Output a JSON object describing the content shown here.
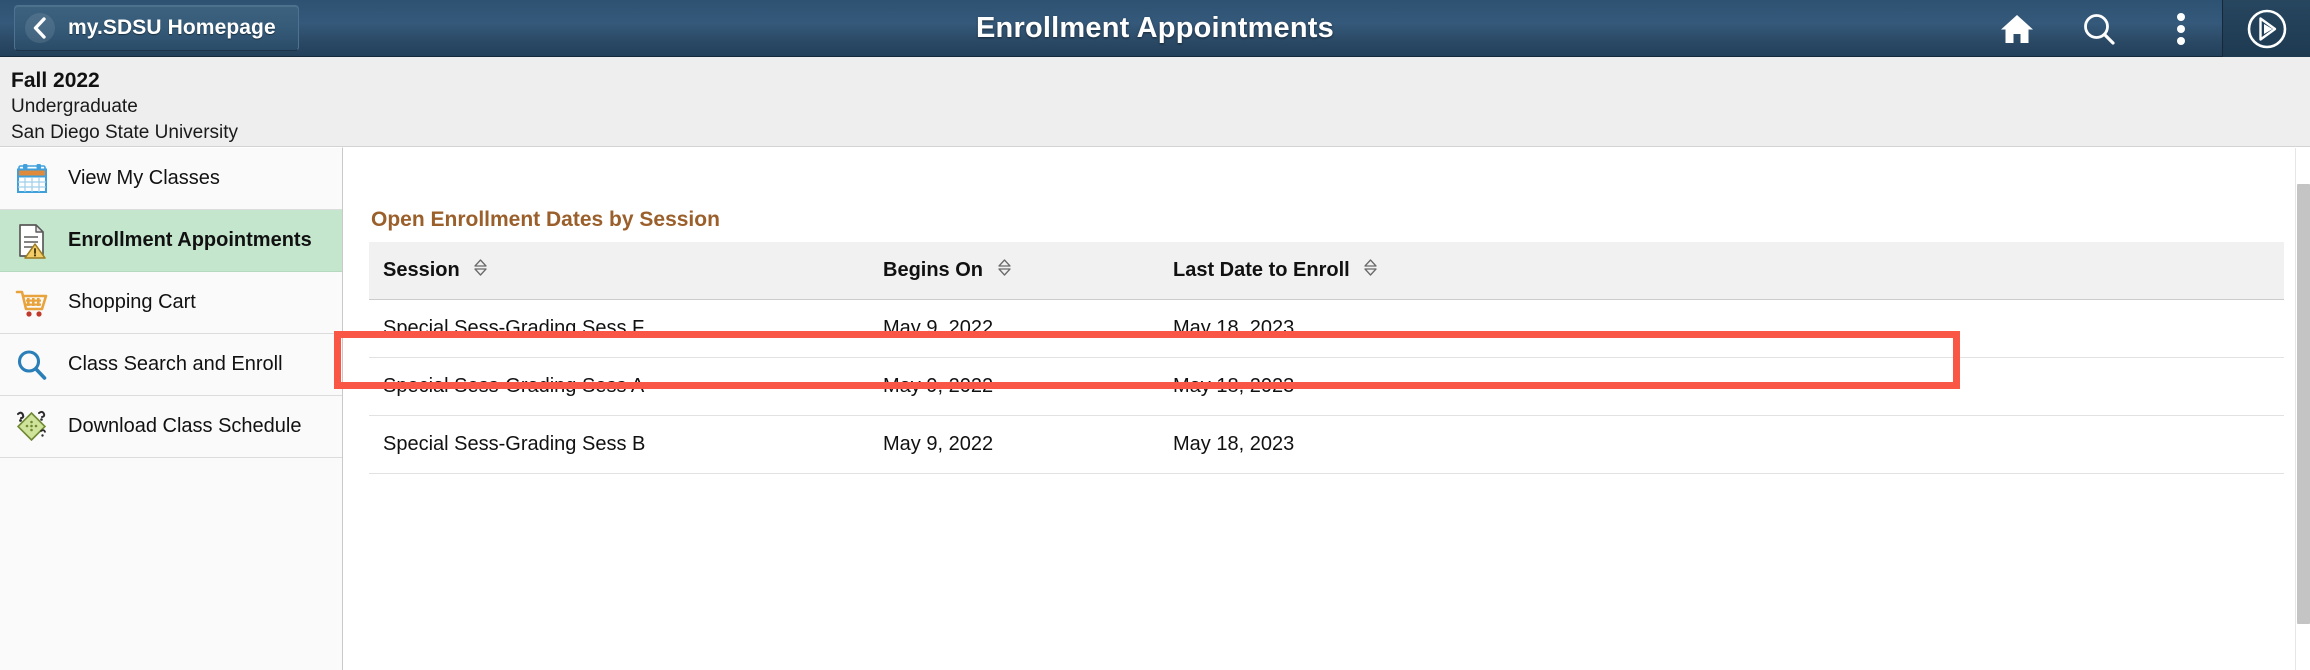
{
  "header": {
    "back_button_label": "my.SDSU Homepage",
    "back_icon": "chevron-left-icon",
    "title": "Enrollment Appointments",
    "icons": [
      {
        "name": "home-icon",
        "label": "Home"
      },
      {
        "name": "search-icon",
        "label": "Search"
      },
      {
        "name": "more-options-icon",
        "label": "Actions"
      },
      {
        "name": "navbar-compass-icon",
        "label": "NavBar"
      }
    ],
    "bar_color": "#2e5272"
  },
  "term_info": {
    "term": "Fall 2022",
    "career": "Undergraduate",
    "institution": "San Diego State University"
  },
  "sidebar": {
    "items": [
      {
        "label": "View My Classes",
        "icon": "calendar-icon",
        "selected": false
      },
      {
        "label": "Enrollment Appointments",
        "icon": "document-warning-icon",
        "selected": true
      },
      {
        "label": "Shopping Cart",
        "icon": "shopping-cart-icon",
        "selected": false
      },
      {
        "label": "Class Search and Enroll",
        "icon": "magnifier-icon",
        "selected": false
      },
      {
        "label": "Download Class Schedule",
        "icon": "green-diamond-icon",
        "selected": false
      }
    ],
    "selected_background": "#c3e6cd"
  },
  "main": {
    "section_title": "Open Enrollment Dates by Session",
    "section_title_color": "#9a5f2b",
    "highlight_color": "#fa5646",
    "table": {
      "columns": [
        {
          "label": "Session",
          "sortable": true
        },
        {
          "label": "Begins On",
          "sortable": true
        },
        {
          "label": "Last Date to Enroll",
          "sortable": true
        }
      ],
      "rows": [
        {
          "session": "Special Sess-Grading Sess F",
          "begins_on": "May 9, 2022",
          "last_date": "May 18, 2023"
        },
        {
          "session": "Special Sess-Grading Sess A",
          "begins_on": "May 9, 2022",
          "last_date": "May 18, 2023"
        },
        {
          "session": "Special Sess-Grading Sess B",
          "begins_on": "May 9, 2022",
          "last_date": "May 18, 2023"
        }
      ]
    }
  }
}
